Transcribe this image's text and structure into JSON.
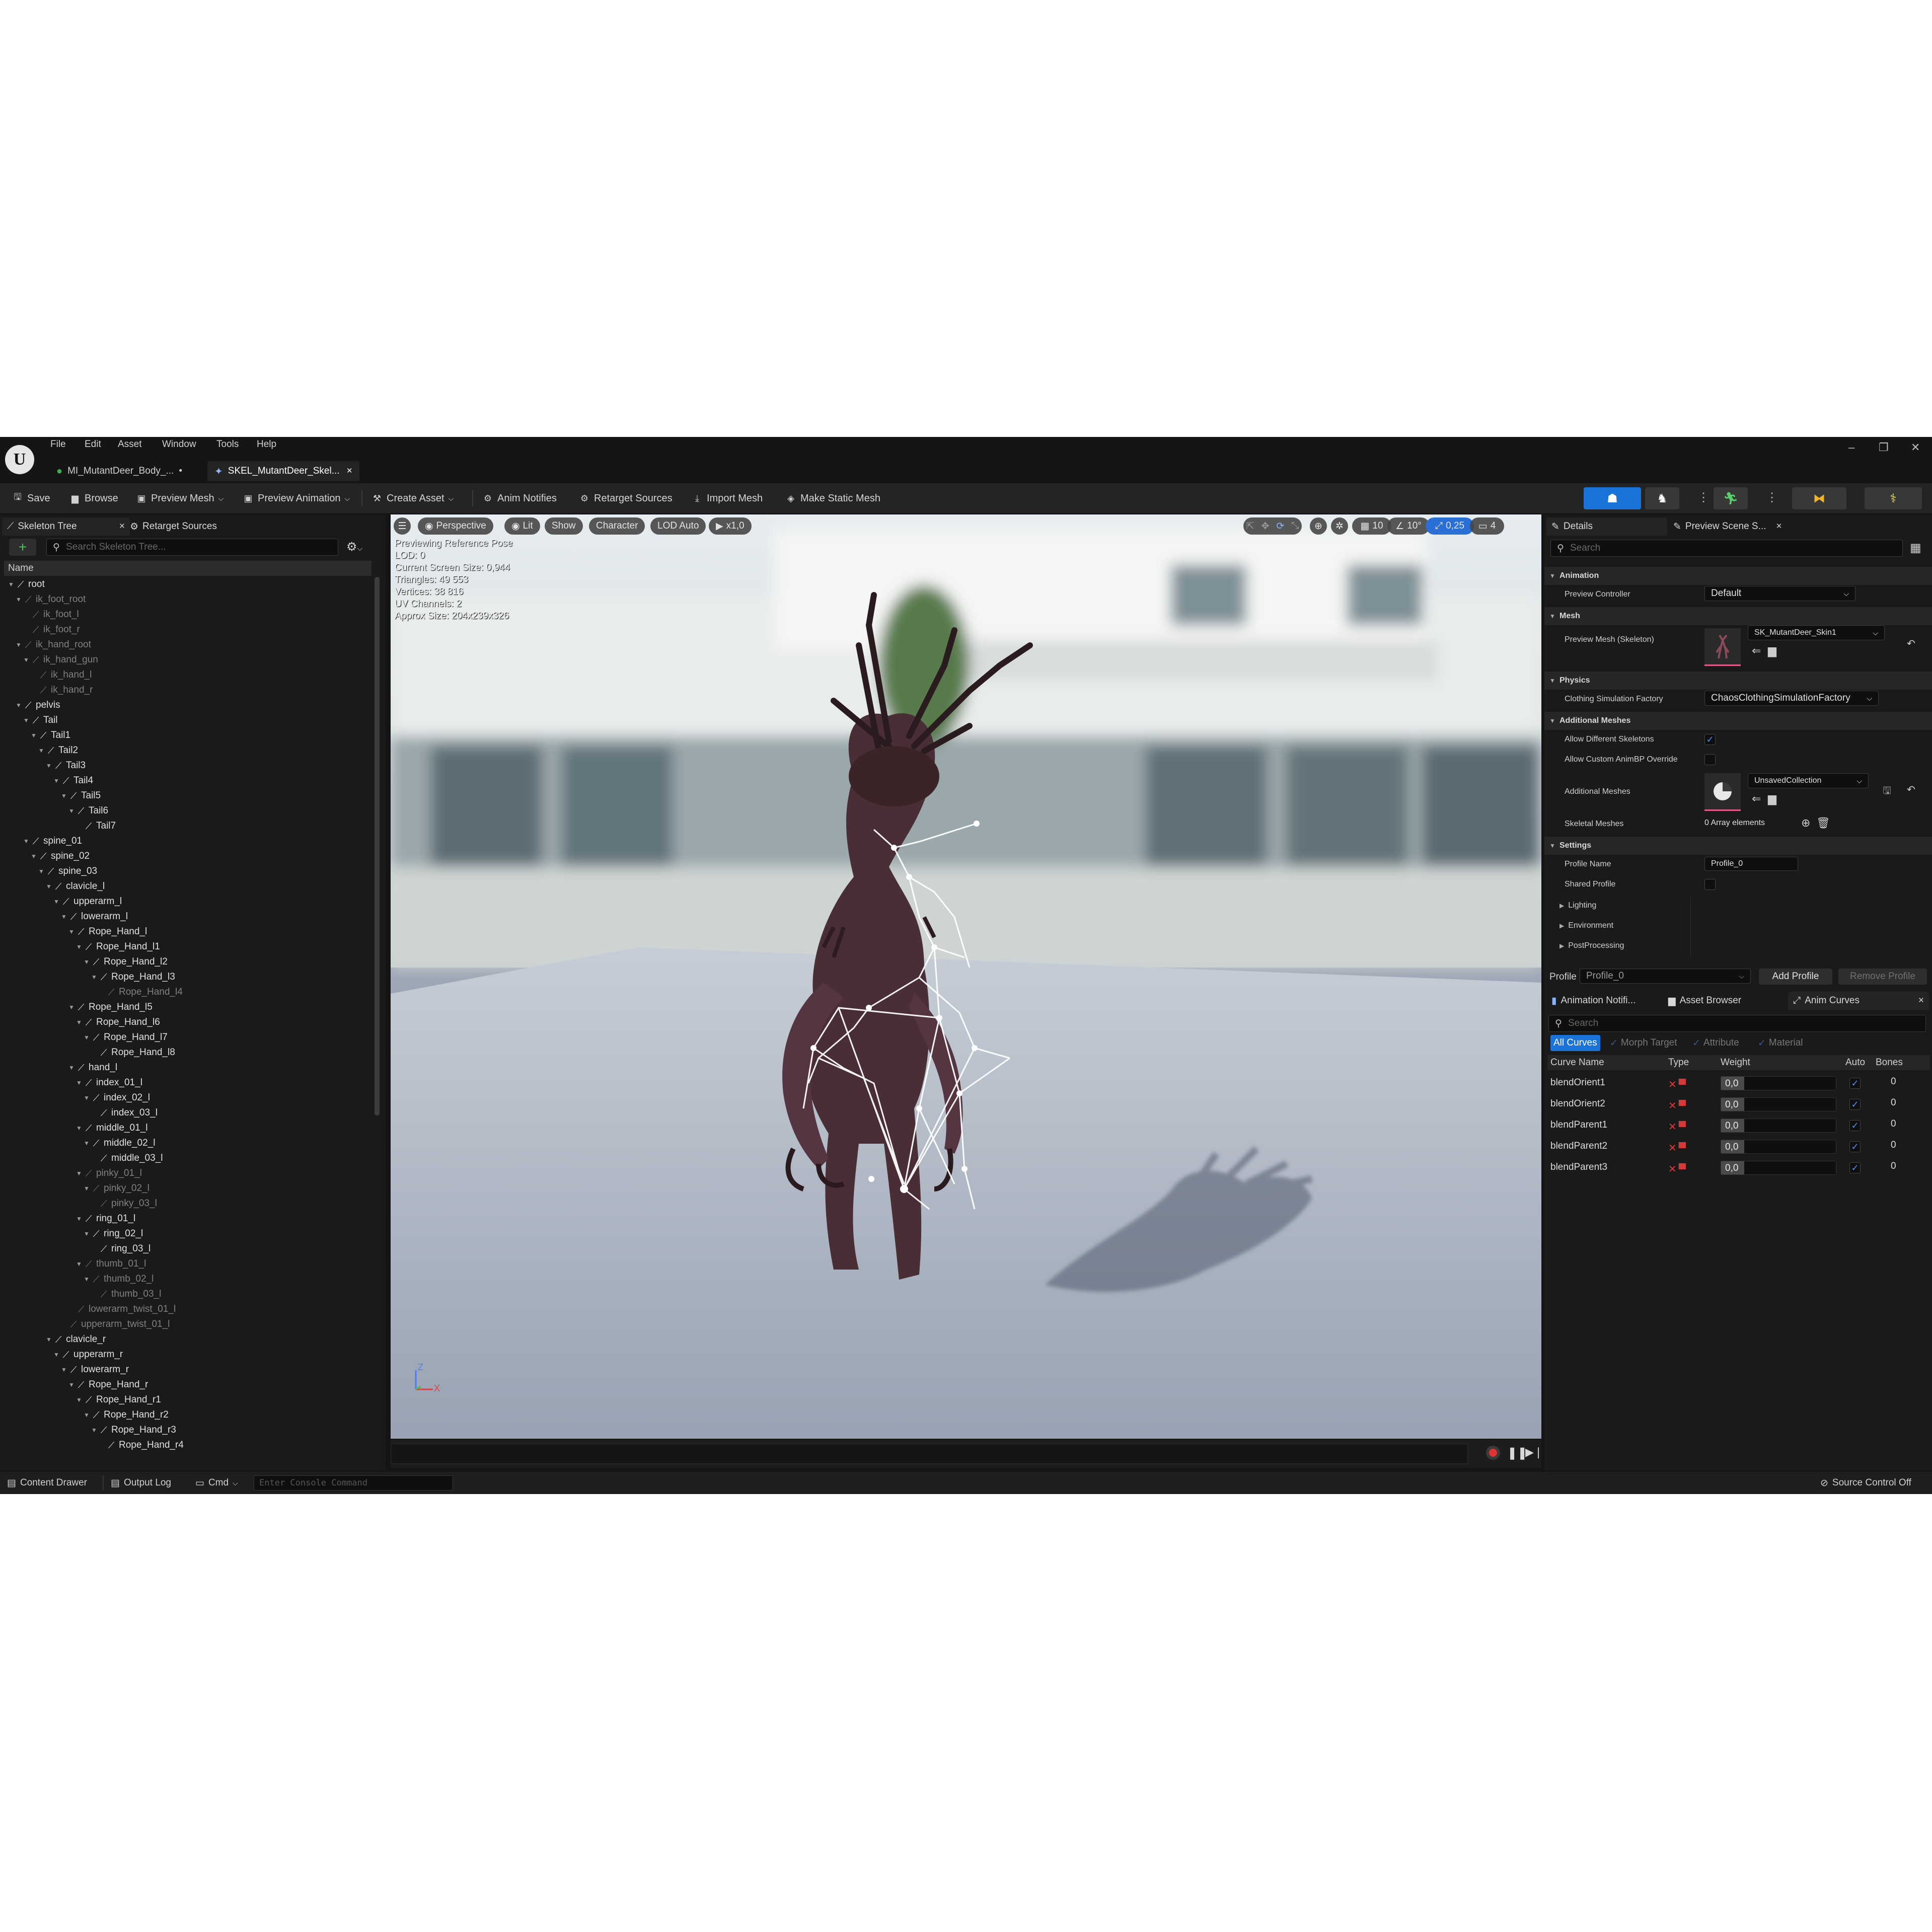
{
  "menu": [
    "File",
    "Edit",
    "Asset",
    "Window",
    "Tools",
    "Help"
  ],
  "tabs": [
    {
      "label": "MI_MutantDeer_Body_...",
      "modified": "•",
      "close": ""
    },
    {
      "label": "SKEL_MutantDeer_Skel...",
      "modified": "",
      "close": "×"
    }
  ],
  "window_controls": [
    "–",
    "❐",
    "✕"
  ],
  "toolbar": {
    "save": "Save",
    "browse": "Browse",
    "preview_mesh": "Preview Mesh",
    "preview_animation": "Preview Animation",
    "create_asset": "Create Asset",
    "anim_notifies": "Anim Notifies",
    "retarget_sources": "Retarget Sources",
    "import_mesh": "Import Mesh",
    "make_static_mesh": "Make Static Mesh"
  },
  "left_panel": {
    "tab_skeleton": "Skeleton Tree",
    "tab_close": "×",
    "tab_retarget": "Retarget Sources",
    "add": "+",
    "search_placeholder": "Search Skeleton Tree...",
    "column_name": "Name",
    "bones": [
      {
        "n": "root",
        "d": 0,
        "dim": false,
        "e": true
      },
      {
        "n": "ik_foot_root",
        "d": 1,
        "dim": true,
        "e": true
      },
      {
        "n": "ik_foot_l",
        "d": 2,
        "dim": true,
        "e": false
      },
      {
        "n": "ik_foot_r",
        "d": 2,
        "dim": true,
        "e": false
      },
      {
        "n": "ik_hand_root",
        "d": 1,
        "dim": true,
        "e": true
      },
      {
        "n": "ik_hand_gun",
        "d": 2,
        "dim": true,
        "e": true
      },
      {
        "n": "ik_hand_l",
        "d": 3,
        "dim": true,
        "e": false
      },
      {
        "n": "ik_hand_r",
        "d": 3,
        "dim": true,
        "e": false
      },
      {
        "n": "pelvis",
        "d": 1,
        "dim": false,
        "e": true
      },
      {
        "n": "Tail",
        "d": 2,
        "dim": false,
        "e": true
      },
      {
        "n": "Tail1",
        "d": 3,
        "dim": false,
        "e": true
      },
      {
        "n": "Tail2",
        "d": 4,
        "dim": false,
        "e": true
      },
      {
        "n": "Tail3",
        "d": 5,
        "dim": false,
        "e": true
      },
      {
        "n": "Tail4",
        "d": 6,
        "dim": false,
        "e": true
      },
      {
        "n": "Tail5",
        "d": 7,
        "dim": false,
        "e": true
      },
      {
        "n": "Tail6",
        "d": 8,
        "dim": false,
        "e": true
      },
      {
        "n": "Tail7",
        "d": 9,
        "dim": false,
        "e": false
      },
      {
        "n": "spine_01",
        "d": 2,
        "dim": false,
        "e": true
      },
      {
        "n": "spine_02",
        "d": 3,
        "dim": false,
        "e": true
      },
      {
        "n": "spine_03",
        "d": 4,
        "dim": false,
        "e": true
      },
      {
        "n": "clavicle_l",
        "d": 5,
        "dim": false,
        "e": true
      },
      {
        "n": "upperarm_l",
        "d": 6,
        "dim": false,
        "e": true
      },
      {
        "n": "lowerarm_l",
        "d": 7,
        "dim": false,
        "e": true
      },
      {
        "n": "Rope_Hand_l",
        "d": 8,
        "dim": false,
        "e": true
      },
      {
        "n": "Rope_Hand_l1",
        "d": 9,
        "dim": false,
        "e": true
      },
      {
        "n": "Rope_Hand_l2",
        "d": 10,
        "dim": false,
        "e": true
      },
      {
        "n": "Rope_Hand_l3",
        "d": 11,
        "dim": false,
        "e": true
      },
      {
        "n": "Rope_Hand_l4",
        "d": 12,
        "dim": true,
        "e": false
      },
      {
        "n": "Rope_Hand_l5",
        "d": 8,
        "dim": false,
        "e": true
      },
      {
        "n": "Rope_Hand_l6",
        "d": 9,
        "dim": false,
        "e": true
      },
      {
        "n": "Rope_Hand_l7",
        "d": 10,
        "dim": false,
        "e": true
      },
      {
        "n": "Rope_Hand_l8",
        "d": 11,
        "dim": false,
        "e": false
      },
      {
        "n": "hand_l",
        "d": 8,
        "dim": false,
        "e": true
      },
      {
        "n": "index_01_l",
        "d": 9,
        "dim": false,
        "e": true
      },
      {
        "n": "index_02_l",
        "d": 10,
        "dim": false,
        "e": true
      },
      {
        "n": "index_03_l",
        "d": 11,
        "dim": false,
        "e": false
      },
      {
        "n": "middle_01_l",
        "d": 9,
        "dim": false,
        "e": true
      },
      {
        "n": "middle_02_l",
        "d": 10,
        "dim": false,
        "e": true
      },
      {
        "n": "middle_03_l",
        "d": 11,
        "dim": false,
        "e": false
      },
      {
        "n": "pinky_01_l",
        "d": 9,
        "dim": true,
        "e": true
      },
      {
        "n": "pinky_02_l",
        "d": 10,
        "dim": true,
        "e": true
      },
      {
        "n": "pinky_03_l",
        "d": 11,
        "dim": true,
        "e": false
      },
      {
        "n": "ring_01_l",
        "d": 9,
        "dim": false,
        "e": true
      },
      {
        "n": "ring_02_l",
        "d": 10,
        "dim": false,
        "e": true
      },
      {
        "n": "ring_03_l",
        "d": 11,
        "dim": false,
        "e": false
      },
      {
        "n": "thumb_01_l",
        "d": 9,
        "dim": true,
        "e": true
      },
      {
        "n": "thumb_02_l",
        "d": 10,
        "dim": true,
        "e": true
      },
      {
        "n": "thumb_03_l",
        "d": 11,
        "dim": true,
        "e": false
      },
      {
        "n": "lowerarm_twist_01_l",
        "d": 8,
        "dim": true,
        "e": false
      },
      {
        "n": "upperarm_twist_01_l",
        "d": 7,
        "dim": true,
        "e": false
      },
      {
        "n": "clavicle_r",
        "d": 5,
        "dim": false,
        "e": true
      },
      {
        "n": "upperarm_r",
        "d": 6,
        "dim": false,
        "e": true
      },
      {
        "n": "lowerarm_r",
        "d": 7,
        "dim": false,
        "e": true
      },
      {
        "n": "Rope_Hand_r",
        "d": 8,
        "dim": false,
        "e": true
      },
      {
        "n": "Rope_Hand_r1",
        "d": 9,
        "dim": false,
        "e": true
      },
      {
        "n": "Rope_Hand_r2",
        "d": 10,
        "dim": false,
        "e": true
      },
      {
        "n": "Rope_Hand_r3",
        "d": 11,
        "dim": false,
        "e": true
      },
      {
        "n": "Rope_Hand_r4",
        "d": 12,
        "dim": false,
        "e": false
      }
    ]
  },
  "viewport": {
    "perspective": "Perspective",
    "lit": "Lit",
    "show": "Show",
    "character": "Character",
    "lod": "LOD Auto",
    "speed": "x1,0",
    "grid": "10",
    "angle": "10°",
    "scale": "0,25",
    "camera_speed": "4",
    "stats": [
      "Previewing Reference Pose",
      "LOD: 0",
      "Current Screen Size: 0,944",
      "Triangles: 49 553",
      "Vertices: 38 816",
      "UV Channels: 2",
      "Approx Size: 204x239x326"
    ],
    "axis_z": "Z",
    "axis_x": "X"
  },
  "details": {
    "tab_details": "Details",
    "tab_scene": "Preview Scene S...",
    "tab_close": "×",
    "search_placeholder": "Search",
    "sec_animation": "Animation",
    "preview_controller_label": "Preview Controller",
    "preview_controller": "Default",
    "sec_mesh": "Mesh",
    "preview_mesh_label": "Preview Mesh (Skeleton)",
    "preview_mesh": "SK_MutantDeer_Skin1",
    "sec_physics": "Physics",
    "clothing_label": "Clothing Simulation Factory",
    "clothing": "ChaosClothingSimulationFactory",
    "sec_additional": "Additional Meshes",
    "allow_diff_label": "Allow Different Skeletons",
    "allow_diff": true,
    "allow_custom_label": "Allow Custom AnimBP Override",
    "allow_custom": false,
    "additional_meshes_label": "Additional Meshes",
    "additional_meshes": "UnsavedCollection",
    "skeletal_meshes_label": "Skeletal Meshes",
    "skeletal_meshes": "0 Array elements",
    "sec_settings": "Settings",
    "profile_name_label": "Profile Name",
    "profile_name": "Profile_0",
    "shared_profile_label": "Shared Profile",
    "shared_profile": false,
    "lighting": "Lighting",
    "environment": "Environment",
    "postprocessing": "PostProcessing",
    "profile_label": "Profile",
    "profile_value": "Profile_0",
    "add_profile": "Add Profile",
    "remove_profile": "Remove Profile"
  },
  "curves": {
    "tab_notifies": "Animation Notifi...",
    "tab_browser": "Asset Browser",
    "tab_curves": "Anim Curves",
    "tab_close": "×",
    "search_placeholder": "Search",
    "filters": {
      "all": "All Curves",
      "morph": "Morph Target",
      "attribute": "Attribute",
      "material": "Material"
    },
    "headers": {
      "name": "Curve Name",
      "type": "Type",
      "weight": "Weight",
      "auto": "Auto",
      "bones": "Bones"
    },
    "rows": [
      {
        "name": "blendOrient1",
        "weight": "0,0",
        "weight_fraction": 0.2,
        "auto": true,
        "bones": "0"
      },
      {
        "name": "blendOrient2",
        "weight": "0,0",
        "weight_fraction": 0.2,
        "auto": true,
        "bones": "0"
      },
      {
        "name": "blendParent1",
        "weight": "0,0",
        "weight_fraction": 0.2,
        "auto": true,
        "bones": "0"
      },
      {
        "name": "blendParent2",
        "weight": "0,0",
        "weight_fraction": 0.2,
        "auto": true,
        "bones": "0"
      },
      {
        "name": "blendParent3",
        "weight": "0,0",
        "weight_fraction": 0.2,
        "auto": true,
        "bones": "0"
      }
    ]
  },
  "statusbar": {
    "content_drawer": "Content Drawer",
    "output_log": "Output Log",
    "cmd": "Cmd",
    "console_placeholder": "Enter Console Command",
    "source_control": "Source Control Off"
  },
  "colors": {
    "accent": "#1a73d9",
    "panel": "#1a1a1a",
    "toolbar": "#242424",
    "red_icon": "#d53a3a"
  }
}
